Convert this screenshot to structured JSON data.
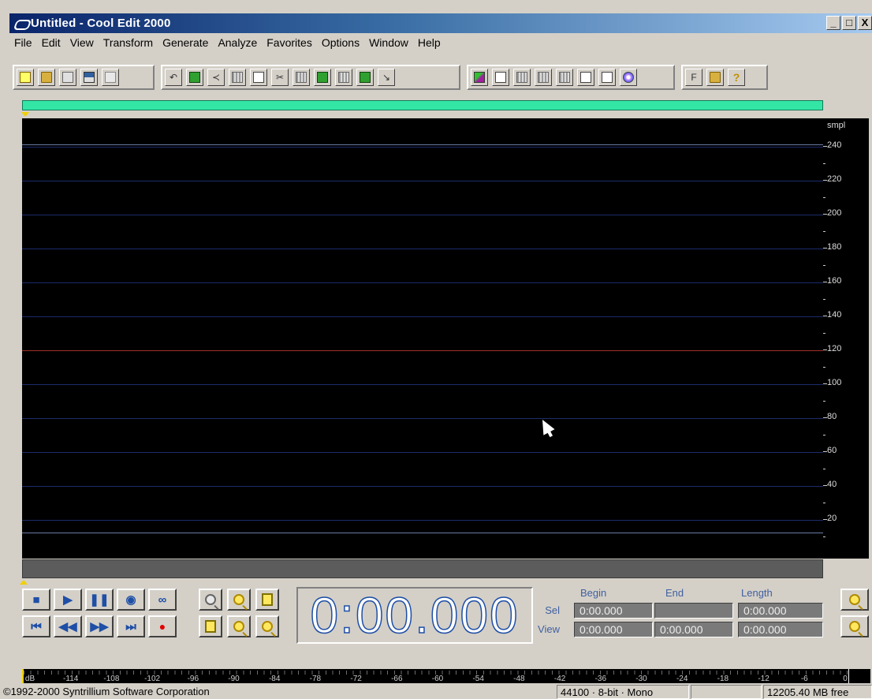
{
  "window": {
    "title": "Untitled - Cool Edit 2000",
    "controls": [
      "_",
      "□",
      "X"
    ]
  },
  "menu": [
    "File",
    "Edit",
    "View",
    "Transform",
    "Generate",
    "Analyze",
    "Favorites",
    "Options",
    "Window",
    "Help"
  ],
  "waveform": {
    "unit": "smpl",
    "ruler_labels": [
      "240",
      "220",
      "200",
      "180",
      "160",
      "140",
      "120",
      "100",
      "80",
      "60",
      "40",
      "20"
    ],
    "center_color": "#a0302a",
    "grid_color": "#1c2c6a",
    "overview_color": "#33e6a6"
  },
  "time_display": "0:00.000",
  "selview": {
    "headers": {
      "begin": "Begin",
      "end": "End",
      "length": "Length"
    },
    "sel_label": "Sel",
    "view_label": "View",
    "sel": {
      "begin": "0:00.000",
      "end": "",
      "length": "0:00.000"
    },
    "view": {
      "begin": "0:00.000",
      "end": "0:00.000",
      "length": "0:00.000"
    }
  },
  "level_meter": {
    "labels": [
      "dB",
      "-114",
      "-108",
      "-102",
      "-96",
      "-90",
      "-84",
      "-78",
      "-72",
      "-66",
      "-60",
      "-54",
      "-48",
      "-42",
      "-36",
      "-30",
      "-24",
      "-18",
      "-12",
      "-6",
      "0"
    ]
  },
  "status": {
    "copyright": "©1992-2000 Syntrillium Software Corporation",
    "format": "44100 · 8-bit · Mono",
    "empty": "",
    "free": "12205.40 MB free"
  }
}
